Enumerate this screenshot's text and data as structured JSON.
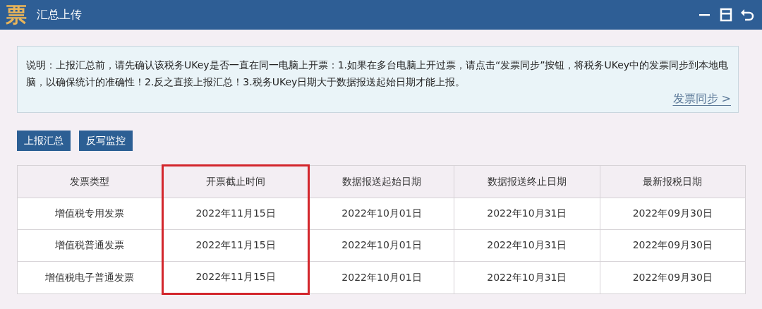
{
  "window": {
    "logo": "票",
    "title": "汇总上传"
  },
  "notice": {
    "text": "说明：上报汇总前，请先确认该税务UKey是否一直在同一电脑上开票：1.如果在多台电脑上开过票，请点击“发票同步”按钮，将税务UKey中的发票同步到本地电脑，以确保统计的准确性！2.反之直接上报汇总！3.税务UKey日期大于数据报送起始日期才能上报。",
    "link": "发票同步 >"
  },
  "buttons": [
    "上报汇总",
    "反写监控"
  ],
  "table": {
    "columns": [
      {
        "label": "发票类型",
        "highlighted": false
      },
      {
        "label": "开票截止时间",
        "highlighted": true
      },
      {
        "label": "数据报送起始日期",
        "highlighted": false
      },
      {
        "label": "数据报送终止日期",
        "highlighted": false
      },
      {
        "label": "最新报税日期",
        "highlighted": false
      }
    ],
    "rows": [
      [
        "增值税专用发票",
        "2022年11月15日",
        "2022年10月01日",
        "2022年10月31日",
        "2022年09月30日"
      ],
      [
        "增值税普通发票",
        "2022年11月15日",
        "2022年10月01日",
        "2022年10月31日",
        "2022年09月30日"
      ],
      [
        "增值税电子普通发票",
        "2022年11月15日",
        "2022年10月01日",
        "2022年10月31日",
        "2022年09月30日"
      ]
    ]
  }
}
